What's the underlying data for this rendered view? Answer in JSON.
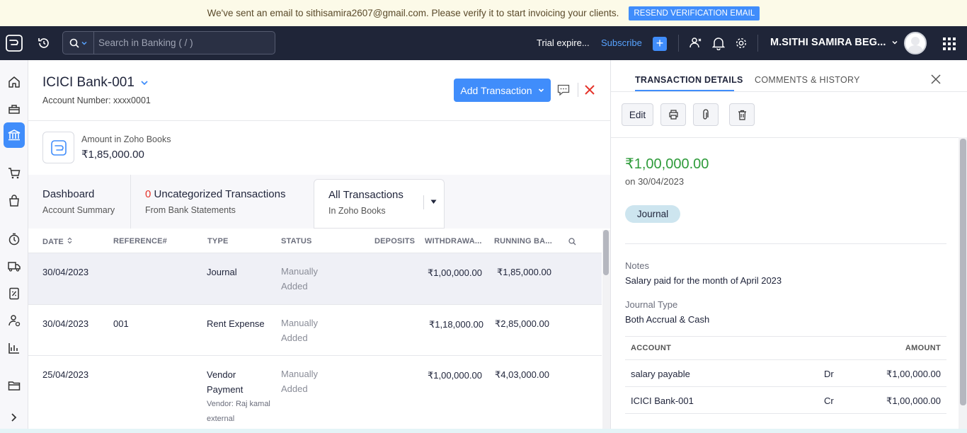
{
  "banner": {
    "message": "We've sent an email to sithisamira2607@gmail.com. Please verify it to start invoicing your clients.",
    "button": "RESEND VERIFICATION EMAIL"
  },
  "topbar": {
    "search_placeholder": "Search in Banking ( / )",
    "trial": "Trial expire...",
    "subscribe": "Subscribe",
    "plus": "+",
    "user": "M.SITHI SAMIRA BEG...",
    "colors": {
      "bg": "#1f2538",
      "accent": "#408dfb"
    }
  },
  "sidebar": {
    "items": [
      "home-icon",
      "items-icon",
      "banking-icon",
      "sales-icon",
      "purchases-icon",
      "time-tracking-icon",
      "eway-bill-icon",
      "gst-filing-icon",
      "accountant-icon",
      "reports-icon",
      "documents-icon",
      "expand-icon"
    ]
  },
  "account": {
    "name": "ICICI Bank-001",
    "number": "Account Number: xxxx0001",
    "add_transaction": "Add Transaction",
    "amount_label": "Amount in Zoho Books",
    "amount_value": "₹1,85,000.00"
  },
  "tabs": {
    "dashboard": {
      "title": "Dashboard",
      "sub": "Account Summary"
    },
    "uncategorized": {
      "count": "0",
      "title": "Uncategorized Transactions",
      "sub": "From Bank Statements"
    },
    "all": {
      "title": "All Transactions",
      "sub": "In Zoho Books"
    }
  },
  "table": {
    "headers": [
      "DATE",
      "REFERENCE#",
      "TYPE",
      "STATUS",
      "DEPOSITS",
      "WITHDRAWA...",
      "RUNNING BA..."
    ],
    "rows": [
      {
        "date": "30/04/2023",
        "reference": "",
        "type1": "Journal",
        "type2": "",
        "status1": "Manually",
        "status2": "Added",
        "deposit": "",
        "withdrawal": "₹1,00,000.00",
        "running": "₹1,85,000.00",
        "vendor1": "",
        "vendor2": ""
      },
      {
        "date": "30/04/2023",
        "reference": "001",
        "type1": "Rent Expense",
        "type2": "",
        "status1": "Manually",
        "status2": "Added",
        "deposit": "",
        "withdrawal": "₹1,18,000.00",
        "running": "₹2,85,000.00",
        "vendor1": "",
        "vendor2": ""
      },
      {
        "date": "25/04/2023",
        "reference": "",
        "type1": "Vendor",
        "type2": "Payment",
        "status1": "Manually",
        "status2": "Added",
        "deposit": "",
        "withdrawal": "₹1,00,000.00",
        "running": "₹4,03,000.00",
        "vendor1": "Vendor: Raj kamal",
        "vendor2": "external"
      }
    ]
  },
  "panel": {
    "tab_details": "TRANSACTION DETAILS",
    "tab_comments": "COMMENTS & HISTORY",
    "edit": "Edit",
    "amount": "₹1,00,000.00",
    "date": "on 30/04/2023",
    "badge": "Journal",
    "notes_label": "Notes",
    "notes": "Salary paid for the month of April 2023",
    "jtype_label": "Journal Type",
    "jtype": "Both Accrual & Cash",
    "jt_headers": {
      "account": "ACCOUNT",
      "amount": "AMOUNT"
    },
    "jt_rows": [
      {
        "account": "salary payable",
        "side": "Dr",
        "amount": "₹1,00,000.00"
      },
      {
        "account": "ICICI Bank-001",
        "side": "Cr",
        "amount": "₹1,00,000.00"
      }
    ],
    "colors": {
      "amount": "#2e9b3a",
      "badge": "#cde5ef"
    }
  }
}
